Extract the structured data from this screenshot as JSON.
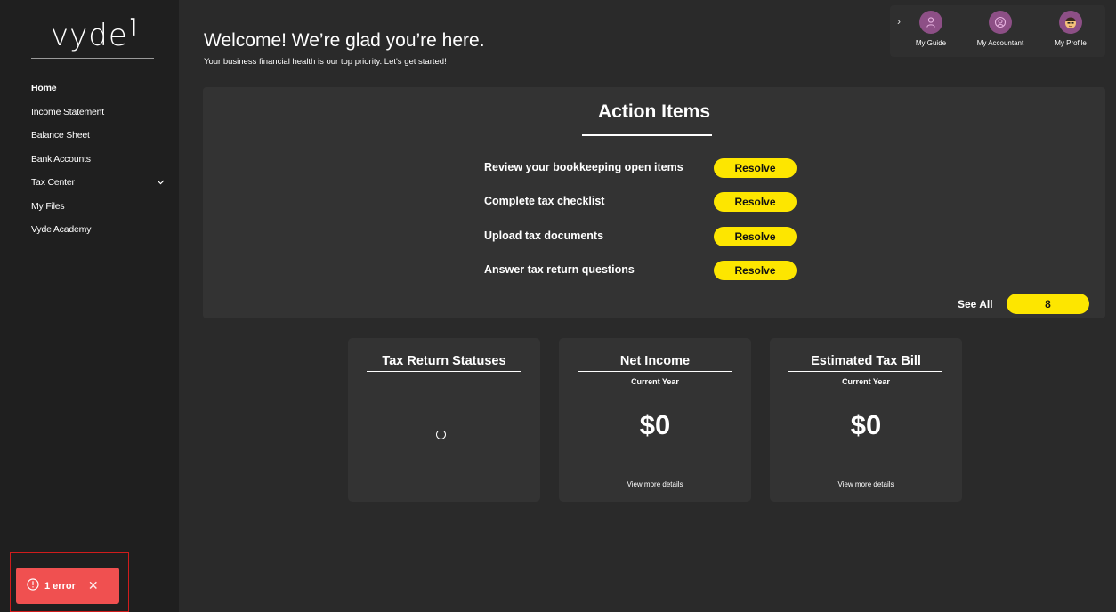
{
  "brand": {
    "name": "vyde",
    "mark": "⌉"
  },
  "sidebar": {
    "items": [
      {
        "label": "Home",
        "active": true
      },
      {
        "label": "Income Statement"
      },
      {
        "label": "Balance Sheet"
      },
      {
        "label": "Bank Accounts"
      },
      {
        "label": "Tax Center",
        "has_dropdown": true
      },
      {
        "label": "My Files"
      },
      {
        "label": "Vyde Academy"
      }
    ]
  },
  "error_toast": {
    "label": "1 error",
    "icon": "error-circle-icon",
    "close_glyph": "✕"
  },
  "header": {
    "title": "Welcome! We’re glad you’re here.",
    "subtitle": "Your business financial health is our top priority. Let's get started!"
  },
  "topbar": {
    "expand_glyph": "›",
    "items": [
      {
        "label": "My Guide",
        "icon": "person-icon"
      },
      {
        "label": "My Accountant",
        "icon": "accountant-icon"
      },
      {
        "label": "My Profile",
        "icon": "profile-avatar-icon"
      }
    ]
  },
  "action_items": {
    "title": "Action Items",
    "items": [
      {
        "text": "Review your bookkeeping open items",
        "button": "Resolve"
      },
      {
        "text": "Complete tax checklist",
        "button": "Resolve"
      },
      {
        "text": "Upload tax documents",
        "button": "Resolve"
      },
      {
        "text": "Answer tax return questions",
        "button": "Resolve"
      }
    ],
    "see_all_label": "See All",
    "count": "8"
  },
  "cards": {
    "tax_return": {
      "title": "Tax Return Statuses"
    },
    "net_income": {
      "title": "Net Income",
      "subtitle": "Current Year",
      "value": "$0",
      "link": "View more details"
    },
    "estimated_tax": {
      "title": "Estimated Tax Bill",
      "subtitle": "Current Year",
      "value": "$0",
      "link": "View more details"
    }
  },
  "colors": {
    "accent": "#fde600",
    "error": "#f05050",
    "avatar": "#8d4f86"
  }
}
